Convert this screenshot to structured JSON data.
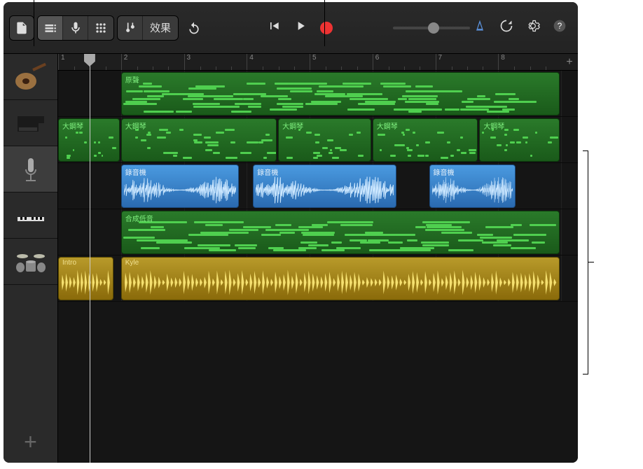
{
  "toolbar": {
    "fx_label": "效果",
    "metronome_color": "#5a8fd8"
  },
  "ruler": {
    "bars": [
      "1",
      "2",
      "3",
      "4",
      "5",
      "6",
      "7",
      "8"
    ]
  },
  "playhead": {
    "bar_position": 1.5
  },
  "tracks": [
    {
      "instrument": "guitar",
      "regions": [
        {
          "type": "midi",
          "label": "原聲",
          "start": 2,
          "end": 9
        }
      ]
    },
    {
      "instrument": "piano",
      "regions": [
        {
          "type": "midi",
          "label": "大鋼琴",
          "start": 1,
          "end": 2
        },
        {
          "type": "midi",
          "label": "大鋼琴",
          "start": 2,
          "end": 4.5
        },
        {
          "type": "midi",
          "label": "大鋼琴",
          "start": 4.5,
          "end": 6
        },
        {
          "type": "midi",
          "label": "大鋼琴",
          "start": 6,
          "end": 7.7
        },
        {
          "type": "midi",
          "label": "大鋼琴",
          "start": 7.7,
          "end": 9
        }
      ]
    },
    {
      "instrument": "mic",
      "selected": true,
      "regions": [
        {
          "type": "audio",
          "label": "錄音機",
          "start": 2,
          "end": 3.9
        },
        {
          "type": "audio",
          "label": "錄音機",
          "start": 4.1,
          "end": 6.4
        },
        {
          "type": "audio",
          "label": "錄音機",
          "start": 6.9,
          "end": 8.3
        }
      ]
    },
    {
      "instrument": "keyboard",
      "regions": [
        {
          "type": "midi",
          "label": "合成低音",
          "start": 2,
          "end": 9
        }
      ]
    },
    {
      "instrument": "drums",
      "regions": [
        {
          "type": "drummer",
          "label": "Intro",
          "start": 1,
          "end": 1.9
        },
        {
          "type": "drummer",
          "label": "Kyle",
          "start": 2,
          "end": 9
        }
      ]
    }
  ],
  "colors": {
    "midi_green": "#2a7a2a",
    "audio_blue": "#4a9ae0",
    "drummer_yellow": "#b89a2a"
  }
}
